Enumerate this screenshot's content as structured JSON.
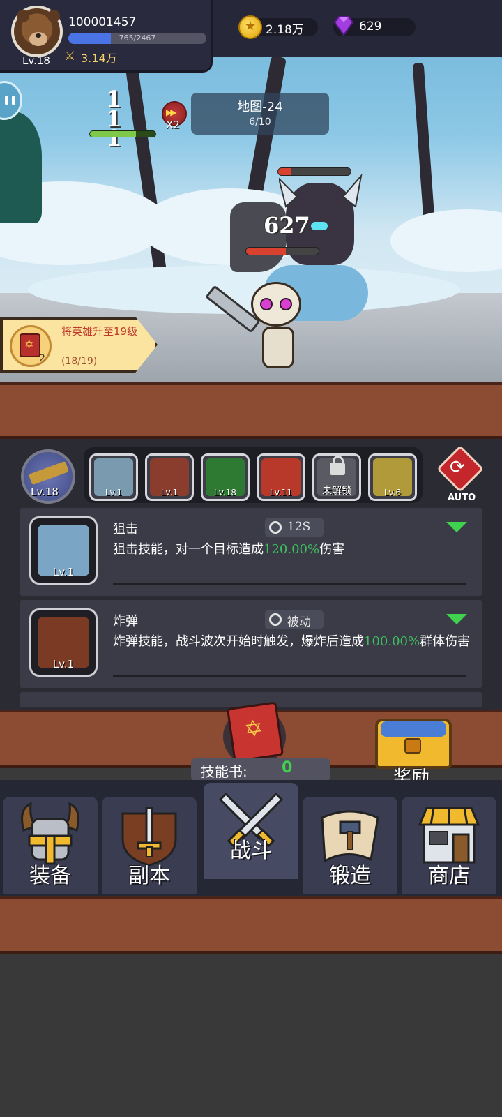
{
  "player": {
    "id": "100001457",
    "level": "Lv.18",
    "exp_text": "765/2467",
    "exp_fraction": 0.31,
    "power": "3.14万"
  },
  "currency": {
    "gold": "2.18万",
    "gems": "629"
  },
  "battle": {
    "combo_text": "1\n1\n1",
    "speed_label": "X2",
    "map_name": "地图-24",
    "map_progress": "6/10",
    "damage_number": "627",
    "hero_hp_fraction": 0.7
  },
  "quest": {
    "text": "将英雄升至19级",
    "progress": "(18/19)",
    "book_count": "2"
  },
  "skill_bar": {
    "hero_weapon_level": "Lv.18",
    "slots": [
      {
        "name": "狙击",
        "level": "Lv.1",
        "color": "#7a9ab0"
      },
      {
        "name": "炸弹",
        "level": "Lv.1",
        "color": "#8a3d2c"
      },
      {
        "name": "green",
        "level": "Lv.18",
        "color": "#2f7a33"
      },
      {
        "name": "red",
        "level": "Lv.11",
        "color": "#b8382a"
      },
      {
        "name": "locked",
        "level": "未解锁",
        "color": "#5a5a63"
      },
      {
        "name": "lightning",
        "level": "Lv.6",
        "color": "#b09a3a"
      }
    ],
    "auto_label": "AUTO"
  },
  "skills": [
    {
      "name": "狙击",
      "cooldown": "12S",
      "level": "Lv.1",
      "desc_before": "狙击技能，对一个目标造成",
      "desc_highlight": "120.00%",
      "desc_after": "伤害",
      "icon_color": "#7aa5c4"
    },
    {
      "name": "炸弹",
      "cooldown": "被动",
      "level": "Lv.1",
      "desc_before": "炸弹技能，战斗波次开始时触发，爆炸后造成",
      "desc_highlight": "100.00%",
      "desc_after": "群体伤害",
      "icon_color": "#7a3a24"
    }
  ],
  "skill_book": {
    "label": "技能书:",
    "value": "0"
  },
  "reward": {
    "label": "奖励"
  },
  "nav": {
    "items": [
      {
        "label": "装备",
        "icon": "viking-helmet-icon"
      },
      {
        "label": "副本",
        "icon": "sword-shield-icon"
      },
      {
        "label": "战斗",
        "icon": "crossed-swords-icon"
      },
      {
        "label": "锻造",
        "icon": "scroll-hammer-icon"
      },
      {
        "label": "商店",
        "icon": "shop-icon"
      }
    ],
    "active_index": 2
  },
  "colors": {
    "accent_green": "#3fbf5f",
    "wood": "#8c4b33",
    "panel": "#2a2b33"
  }
}
